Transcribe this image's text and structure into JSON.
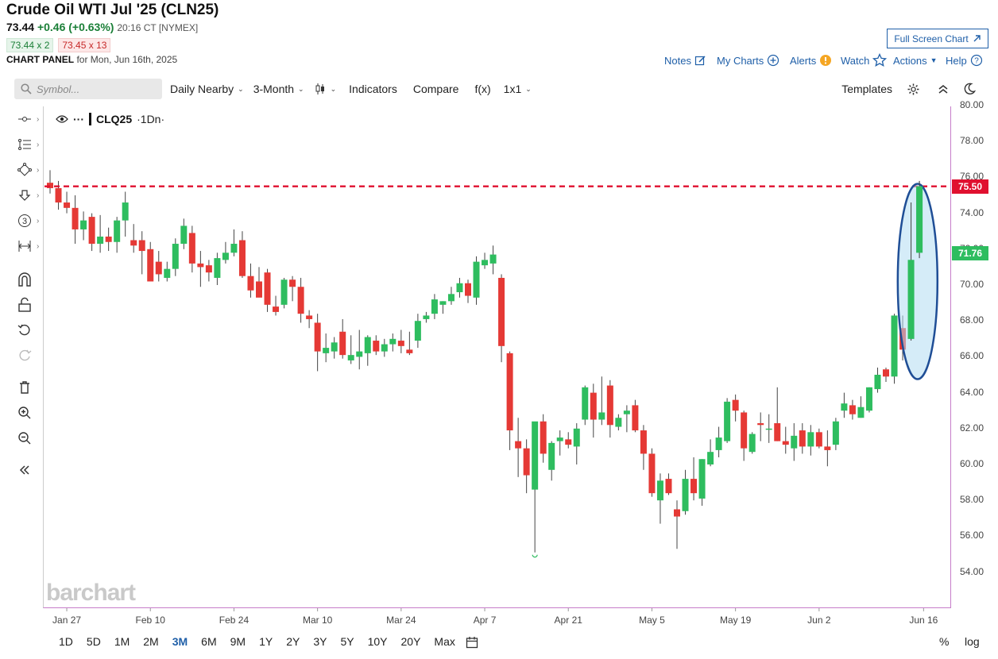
{
  "header": {
    "title": "Crude Oil WTI Jul '25 (CLN25)",
    "last": "73.44",
    "change": "+0.46 (+0.63%)",
    "time": "20:16 CT [NYMEX]",
    "bid": "73.44 x 2",
    "ask": "73.45 x 13",
    "panel_label": "CHART PANEL",
    "panel_date": "for Mon, Jun 16th, 2025",
    "fullscreen_label": "Full Screen Chart"
  },
  "topnav": {
    "notes": "Notes",
    "my_charts": "My Charts",
    "alerts": "Alerts",
    "watch": "Watch",
    "actions": "Actions",
    "help": "Help"
  },
  "toolbar": {
    "search_placeholder": "Symbol...",
    "aggregation": "Daily Nearby",
    "period": "3-Month",
    "indicators": "Indicators",
    "compare": "Compare",
    "fx": "f(x)",
    "layout": "1x1",
    "templates": "Templates"
  },
  "legend": {
    "symbol": "CLQ25",
    "suffix": "·1Dn·"
  },
  "price_tags": {
    "red": "75.50",
    "green": "71.76"
  },
  "watermark": "barchart",
  "bottom": {
    "ranges": [
      "1D",
      "5D",
      "1M",
      "2M",
      "3M",
      "6M",
      "9M",
      "1Y",
      "2Y",
      "3Y",
      "5Y",
      "10Y",
      "20Y",
      "Max"
    ],
    "active": "3M",
    "pct": "%",
    "log": "log"
  },
  "colors": {
    "up": "#2ebd5f",
    "down": "#e53935",
    "accent": "#1f5fa8",
    "reference_line": "#e0102f",
    "ellipse_fill": "#b3dcf2"
  },
  "chart_data": {
    "type": "candlestick",
    "symbol": "CLQ25",
    "ylim": [
      53,
      81
    ],
    "yticks": [
      "80.00",
      "78.00",
      "76.00",
      "74.00",
      "72.00",
      "70.00",
      "68.00",
      "66.00",
      "64.00",
      "62.00",
      "60.00",
      "58.00",
      "56.00",
      "54.00"
    ],
    "xtick_labels": [
      "Jan 27",
      "Feb 10",
      "Feb 24",
      "Mar 10",
      "Mar 24",
      "Apr 7",
      "Apr 21",
      "May 5",
      "May 19",
      "Jun 2",
      "Jun 16"
    ],
    "reference_line": 75.5,
    "last_price_tag": 71.76,
    "candles": [
      [
        75.7,
        76.4,
        75.1,
        75.4
      ],
      [
        75.4,
        75.8,
        74.2,
        74.6
      ],
      [
        74.6,
        75.2,
        74.0,
        74.3
      ],
      [
        74.3,
        75.0,
        72.3,
        73.1
      ],
      [
        73.1,
        74.1,
        72.5,
        73.6
      ],
      [
        73.8,
        74.0,
        71.9,
        72.3
      ],
      [
        72.3,
        73.9,
        71.8,
        72.7
      ],
      [
        72.7,
        73.2,
        71.9,
        72.4
      ],
      [
        72.4,
        73.8,
        71.8,
        73.6
      ],
      [
        73.6,
        75.2,
        72.7,
        74.6
      ],
      [
        72.5,
        73.4,
        71.8,
        72.2
      ],
      [
        72.5,
        73.0,
        70.6,
        71.9
      ],
      [
        72.0,
        72.4,
        70.6,
        70.2
      ],
      [
        71.3,
        71.9,
        70.2,
        70.6
      ],
      [
        70.4,
        71.3,
        70.2,
        70.9
      ],
      [
        70.9,
        72.6,
        70.5,
        72.3
      ],
      [
        72.3,
        73.7,
        72.0,
        73.3
      ],
      [
        72.9,
        73.3,
        70.7,
        71.2
      ],
      [
        71.2,
        71.9,
        69.9,
        71.0
      ],
      [
        71.1,
        71.4,
        70.2,
        70.7
      ],
      [
        70.4,
        71.8,
        70.0,
        71.5
      ],
      [
        71.4,
        72.4,
        71.2,
        71.8
      ],
      [
        71.8,
        73.1,
        71.6,
        72.3
      ],
      [
        72.5,
        73.0,
        70.4,
        70.5
      ],
      [
        70.5,
        71.2,
        69.3,
        69.7
      ],
      [
        70.2,
        71.0,
        69.5,
        69.3
      ],
      [
        70.7,
        70.9,
        68.5,
        68.9
      ],
      [
        68.8,
        69.4,
        68.3,
        68.5
      ],
      [
        68.9,
        70.4,
        68.7,
        70.3
      ],
      [
        70.3,
        70.5,
        69.1,
        69.9
      ],
      [
        69.9,
        70.4,
        67.9,
        68.4
      ],
      [
        68.3,
        68.6,
        67.6,
        68.1
      ],
      [
        67.9,
        68.4,
        65.2,
        66.3
      ],
      [
        66.2,
        67.3,
        65.7,
        66.5
      ],
      [
        66.3,
        67.1,
        65.9,
        66.8
      ],
      [
        67.4,
        68.1,
        65.9,
        66.1
      ],
      [
        65.8,
        67.2,
        65.6,
        66.1
      ],
      [
        66.0,
        67.5,
        65.3,
        66.3
      ],
      [
        66.2,
        67.2,
        65.5,
        67.1
      ],
      [
        66.9,
        67.2,
        66.1,
        66.3
      ],
      [
        66.3,
        67.0,
        66.0,
        66.7
      ],
      [
        66.7,
        67.3,
        66.3,
        67.0
      ],
      [
        66.9,
        67.5,
        66.2,
        66.6
      ],
      [
        66.4,
        67.4,
        66.1,
        66.2
      ],
      [
        66.9,
        68.4,
        66.5,
        68.0
      ],
      [
        68.1,
        68.5,
        67.9,
        68.3
      ],
      [
        68.4,
        69.5,
        68.1,
        69.2
      ],
      [
        68.9,
        69.1,
        68.4,
        69.1
      ],
      [
        69.1,
        69.9,
        68.9,
        69.5
      ],
      [
        69.6,
        70.4,
        69.3,
        70.1
      ],
      [
        70.1,
        70.3,
        69.0,
        69.4
      ],
      [
        69.3,
        71.6,
        68.9,
        71.3
      ],
      [
        71.1,
        71.8,
        70.9,
        71.4
      ],
      [
        71.2,
        72.2,
        70.6,
        71.7
      ],
      [
        70.4,
        70.6,
        65.7,
        66.6
      ],
      [
        66.2,
        66.3,
        60.8,
        61.9
      ],
      [
        61.3,
        62.6,
        59.3,
        60.9
      ],
      [
        60.9,
        61.4,
        58.4,
        59.4
      ],
      [
        58.6,
        61.5,
        55.1,
        62.4
      ],
      [
        62.4,
        62.8,
        60.1,
        60.6
      ],
      [
        59.7,
        61.3,
        59.1,
        61.2
      ],
      [
        61.3,
        61.9,
        60.5,
        61.5
      ],
      [
        61.4,
        61.8,
        60.9,
        61.1
      ],
      [
        61.0,
        62.3,
        60.0,
        62.0
      ],
      [
        62.5,
        64.4,
        62.2,
        64.3
      ],
      [
        64.0,
        64.5,
        61.5,
        62.5
      ],
      [
        62.5,
        64.9,
        62.2,
        62.9
      ],
      [
        64.4,
        64.7,
        61.5,
        62.2
      ],
      [
        62.1,
        62.8,
        61.9,
        62.6
      ],
      [
        62.8,
        63.3,
        61.8,
        63.0
      ],
      [
        63.3,
        63.6,
        61.8,
        61.9
      ],
      [
        61.9,
        62.2,
        59.7,
        60.6
      ],
      [
        60.6,
        60.9,
        58.2,
        58.4
      ],
      [
        58.0,
        59.5,
        56.7,
        59.1
      ],
      [
        59.2,
        59.5,
        58.3,
        58.4
      ],
      [
        57.5,
        58.0,
        55.3,
        57.1
      ],
      [
        57.4,
        59.7,
        57.2,
        59.2
      ],
      [
        59.2,
        60.4,
        58.0,
        58.4
      ],
      [
        58.1,
        60.3,
        57.7,
        60.3
      ],
      [
        60.0,
        61.4,
        59.9,
        60.7
      ],
      [
        60.8,
        62.1,
        60.4,
        61.5
      ],
      [
        61.3,
        63.7,
        61.2,
        63.5
      ],
      [
        63.6,
        63.9,
        62.4,
        63.0
      ],
      [
        62.9,
        63.0,
        60.2,
        60.9
      ],
      [
        60.7,
        61.8,
        60.6,
        61.7
      ],
      [
        62.3,
        62.9,
        61.3,
        62.2
      ],
      [
        62.0,
        62.8,
        61.2,
        62.0
      ],
      [
        62.3,
        64.3,
        61.3,
        61.3
      ],
      [
        61.3,
        62.1,
        60.6,
        61.1
      ],
      [
        60.9,
        62.3,
        60.2,
        61.6
      ],
      [
        61.9,
        62.3,
        60.6,
        61.0
      ],
      [
        61.0,
        62.2,
        60.5,
        61.8
      ],
      [
        61.8,
        62.0,
        60.9,
        61.0
      ],
      [
        61.0,
        61.9,
        59.9,
        60.8
      ],
      [
        61.1,
        62.6,
        60.8,
        62.4
      ],
      [
        63.0,
        64.0,
        62.6,
        63.4
      ],
      [
        63.3,
        63.6,
        62.5,
        62.8
      ],
      [
        62.6,
        63.8,
        62.6,
        63.2
      ],
      [
        63.0,
        64.3,
        62.9,
        64.3
      ],
      [
        64.2,
        65.4,
        64.0,
        65.0
      ],
      [
        65.3,
        65.4,
        64.6,
        64.9
      ],
      [
        64.9,
        68.4,
        64.5,
        68.3
      ],
      [
        67.6,
        68.3,
        65.8,
        66.4
      ],
      [
        67.0,
        74.6,
        66.9,
        71.4
      ],
      [
        71.8,
        75.8,
        71.5,
        75.5
      ]
    ]
  }
}
